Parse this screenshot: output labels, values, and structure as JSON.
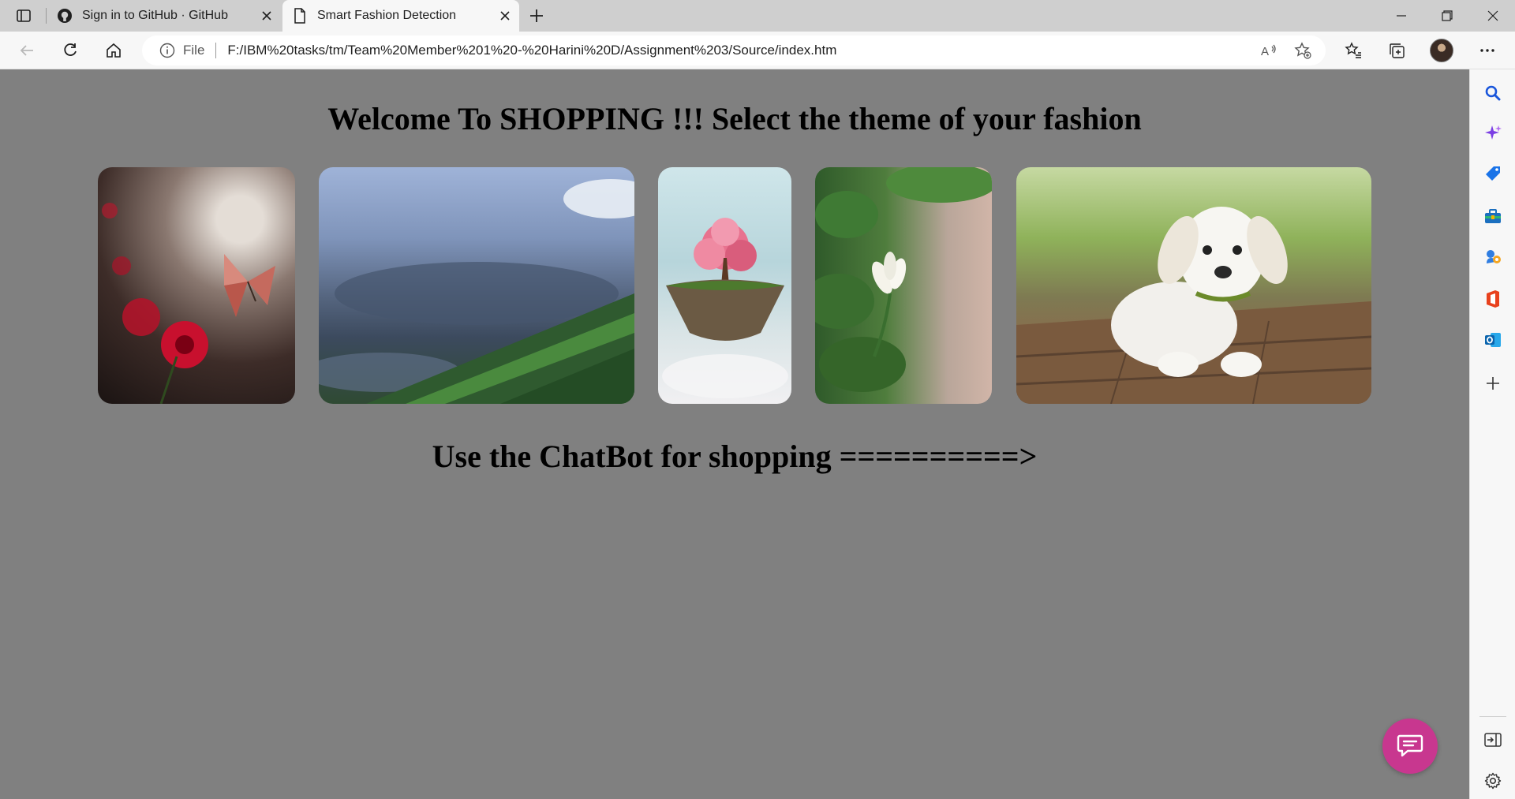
{
  "browser": {
    "tabs": [
      {
        "title": "Sign in to GitHub · GitHub",
        "icon": "github-icon",
        "active": false
      },
      {
        "title": "Smart Fashion Detection",
        "icon": "page-icon",
        "active": true
      }
    ],
    "address_bar": {
      "scheme_label": "File",
      "url": "F:/IBM%20tasks/tm/Team%20Member%201%20-%20Harini%20D/Assignment%203/Source/index.htm"
    },
    "sidebar_icons": [
      "search-icon",
      "copilot-icon",
      "shopping-icon",
      "tools-icon",
      "games-icon",
      "office-icon",
      "outlook-icon",
      "add-icon"
    ]
  },
  "page": {
    "heading": "Welcome To SHOPPING !!! Select the theme of your fashion",
    "gallery": [
      {
        "name": "butterfly",
        "subject": "Butterfly with red flowers"
      },
      {
        "name": "cloudy-sky",
        "subject": "Cloudy sky over green fields"
      },
      {
        "name": "floating-tree",
        "subject": "Pink tree on floating island"
      },
      {
        "name": "white-flower",
        "subject": "White jasmine flower bud"
      },
      {
        "name": "puppy",
        "subject": "White puppy on wooden deck"
      }
    ],
    "chatbot_prompt": "Use the ChatBot for shopping ==========>",
    "accent_color": "#c8378f",
    "background_color": "#808080"
  }
}
